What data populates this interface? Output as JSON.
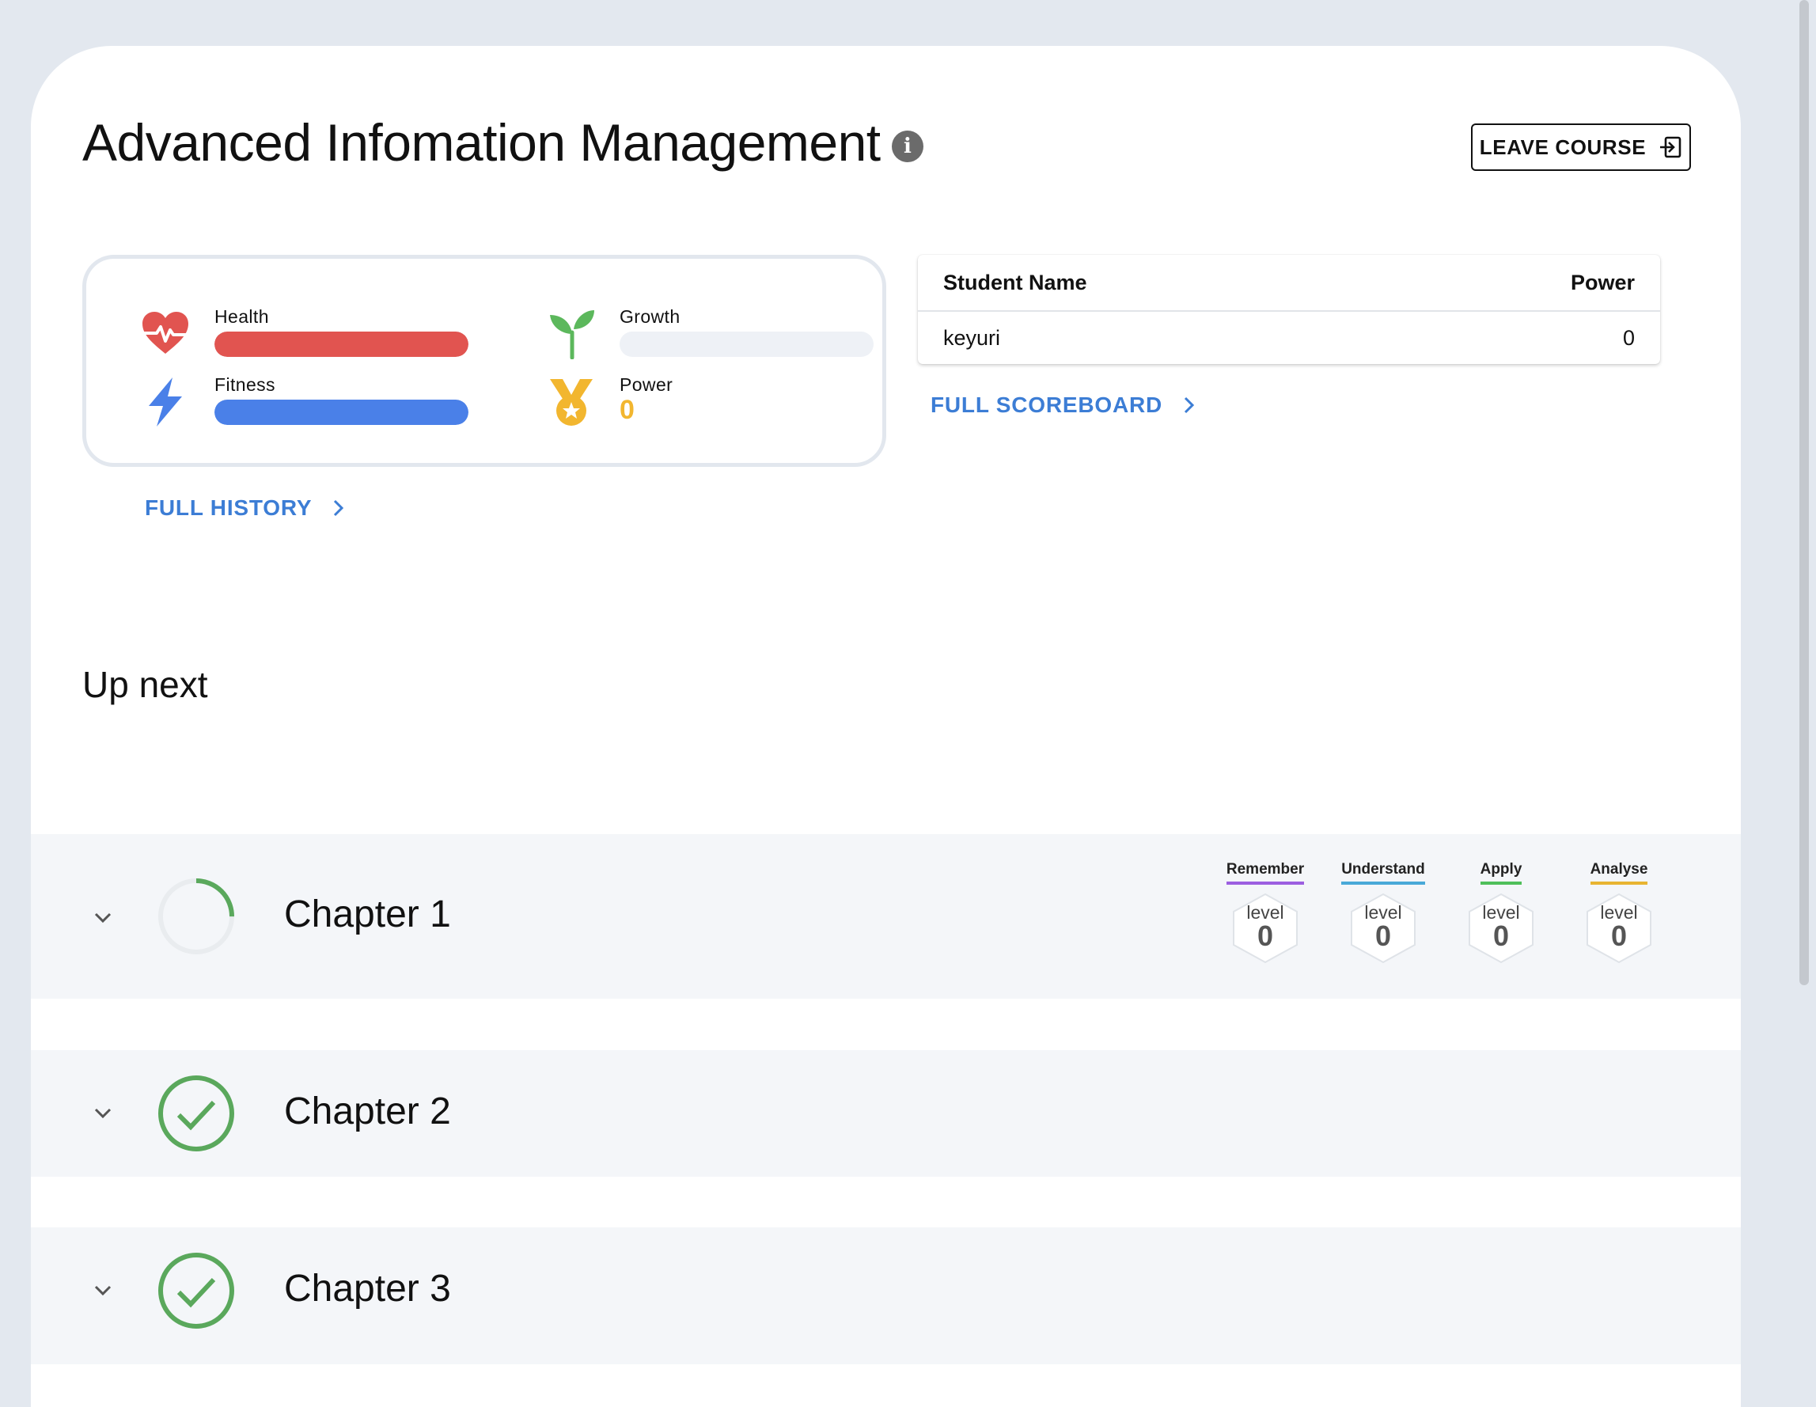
{
  "header": {
    "title": "Advanced Infomation Management",
    "leave_label": "LEAVE COURSE"
  },
  "stats": {
    "health": {
      "label": "Health",
      "level": 1.0,
      "color": "#e15450"
    },
    "growth": {
      "label": "Growth",
      "level": 0.0,
      "color": "#5cb85c"
    },
    "fitness": {
      "label": "Fitness",
      "level": 1.0,
      "color": "#4a80e8"
    },
    "power": {
      "label": "Power",
      "value": "0",
      "color": "#f2b62f"
    }
  },
  "links": {
    "full_history": "FULL HISTORY",
    "full_scoreboard": "FULL SCOREBOARD"
  },
  "scoreboard": {
    "columns": [
      "Student Name",
      "Power"
    ],
    "rows": [
      {
        "name": "keyuri",
        "power": "0"
      }
    ]
  },
  "up_next": "Up next",
  "chapters": [
    {
      "title": "Chapter 1",
      "status": "in-progress",
      "progress": 0.25
    },
    {
      "title": "Chapter 2",
      "status": "complete"
    },
    {
      "title": "Chapter 3",
      "status": "complete"
    }
  ],
  "blooms": [
    {
      "name": "Remember",
      "level_label": "level",
      "level": "0",
      "color": "#9c5fe0"
    },
    {
      "name": "Understand",
      "level_label": "level",
      "level": "0",
      "color": "#49a9d8"
    },
    {
      "name": "Apply",
      "level_label": "level",
      "level": "0",
      "color": "#4fbf5a"
    },
    {
      "name": "Analyse",
      "level_label": "level",
      "level": "0",
      "color": "#e8b431"
    }
  ]
}
